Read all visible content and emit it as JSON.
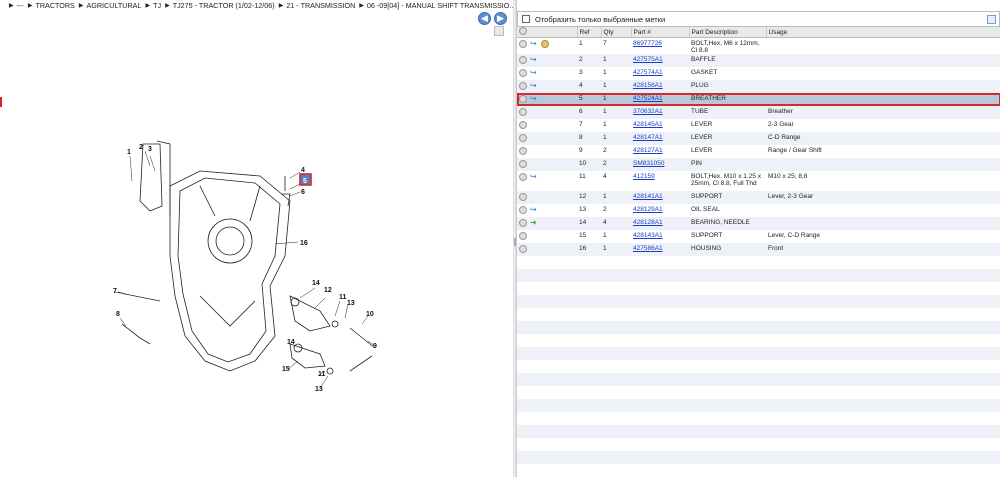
{
  "breadcrumb": [
    "--- ",
    "TRACTORS",
    "AGRICULTURAL",
    "TJ",
    "TJ275 - TRACTOR (1/02-12/06)",
    "21 - TRANSMISSION",
    "06 -09[04] - MANUAL SHIFT TRANSMISSIO..."
  ],
  "nav": {
    "back": "◀",
    "forward": "▶"
  },
  "filter": {
    "label": "Отобразить только выбранные метки"
  },
  "columns": [
    "Ref",
    "Qty",
    "Part #",
    "Part Description",
    "Usage"
  ],
  "rows": [
    {
      "ref": "1",
      "qty": "7",
      "part": "86977726",
      "desc": "BOLT,Hex, M6 x 12mm, Cl 8.8",
      "usage": "",
      "icons": [
        "gear",
        "arrow",
        "badge"
      ]
    },
    {
      "ref": "2",
      "qty": "1",
      "part": "427575A1",
      "desc": "BAFFLE",
      "usage": "",
      "icons": [
        "gear",
        "arrow"
      ]
    },
    {
      "ref": "3",
      "qty": "1",
      "part": "427574A1",
      "desc": "GASKET",
      "usage": "",
      "icons": [
        "gear",
        "arrow"
      ]
    },
    {
      "ref": "4",
      "qty": "1",
      "part": "428156A1",
      "desc": "PLUG",
      "usage": "",
      "icons": [
        "gear",
        "arrow"
      ]
    },
    {
      "ref": "5",
      "qty": "1",
      "part": "427524A1",
      "desc": "BREATHER",
      "usage": "",
      "icons": [
        "gear",
        "arrow"
      ],
      "selected": true
    },
    {
      "ref": "6",
      "qty": "1",
      "part": "370632A1",
      "desc": "TUBE",
      "usage": "Breather",
      "icons": [
        "gear"
      ]
    },
    {
      "ref": "7",
      "qty": "1",
      "part": "428145A1",
      "desc": "LEVER",
      "usage": "2-3 Gear",
      "icons": [
        "gear"
      ]
    },
    {
      "ref": "8",
      "qty": "1",
      "part": "428147A1",
      "desc": "LEVER",
      "usage": "C-D Range",
      "icons": [
        "gear"
      ]
    },
    {
      "ref": "9",
      "qty": "2",
      "part": "428127A1",
      "desc": "LEVER",
      "usage": "Range / Gear Shift",
      "icons": [
        "gear"
      ]
    },
    {
      "ref": "10",
      "qty": "2",
      "part": "SM831050",
      "desc": "PIN",
      "usage": "",
      "icons": [
        "gear"
      ]
    },
    {
      "ref": "11",
      "qty": "4",
      "part": "412159",
      "desc": "BOLT,Hex, M10 x 1.25 x 25mm, Cl 8.8, Full Thd",
      "usage": "M10 x 25; 8,8",
      "icons": [
        "gear",
        "arrow"
      ]
    },
    {
      "ref": "12",
      "qty": "1",
      "part": "428141A1",
      "desc": "SUPPORT",
      "usage": "Lever, 2-3 Gear",
      "icons": [
        "gear"
      ]
    },
    {
      "ref": "13",
      "qty": "2",
      "part": "428129A1",
      "desc": "OIL SEAL",
      "usage": "",
      "icons": [
        "gear",
        "arrow"
      ]
    },
    {
      "ref": "14",
      "qty": "4",
      "part": "428128A1",
      "desc": "BEARING, NEEDLE",
      "usage": "",
      "icons": [
        "gear",
        "arrow-green"
      ]
    },
    {
      "ref": "15",
      "qty": "1",
      "part": "428143A1",
      "desc": "SUPPORT",
      "usage": "Lever, C-D Range",
      "icons": [
        "gear"
      ]
    },
    {
      "ref": "16",
      "qty": "1",
      "part": "427586A1",
      "desc": "HOUSING",
      "usage": "Front",
      "icons": [
        "gear"
      ]
    }
  ],
  "diagram": {
    "callouts": [
      "1",
      "2",
      "3",
      "4",
      "5",
      "6",
      "7",
      "8",
      "9",
      "10",
      "11",
      "12",
      "13",
      "14",
      "15",
      "16"
    ]
  }
}
